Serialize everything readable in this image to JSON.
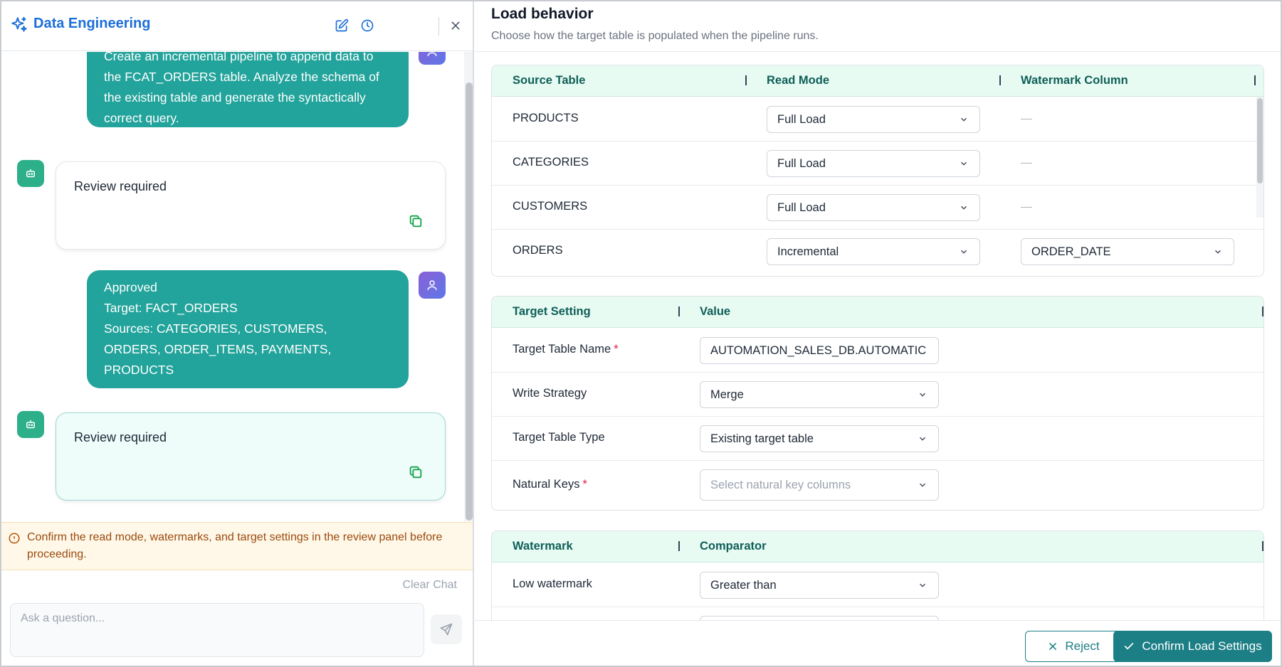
{
  "chat": {
    "title": "Data Engineering",
    "messages": {
      "user1_line1": "Create an incremental pipeline to append data to",
      "user1_line2": "the FCAT_ORDERS table. Analyze the schema of",
      "user1_line3": "the existing table and generate the syntactically",
      "user1_line4": "correct query.",
      "bot1": "Review required",
      "user2_line1": "Approved",
      "user2_line2": "Target: FACT_ORDERS",
      "user2_line3": "Sources: CATEGORIES, CUSTOMERS,",
      "user2_line4": "ORDERS, ORDER_ITEMS, PAYMENTS,",
      "user2_line5": "PRODUCTS",
      "bot2": "Review required"
    },
    "warning": "Confirm the read mode, watermarks, and target settings in the review panel before proceeding.",
    "clear_chat": "Clear Chat",
    "input_placeholder": "Ask a question..."
  },
  "review": {
    "title": "Load behavior",
    "subtitle": "Choose how the target table is populated when the pipeline runs.",
    "sources": {
      "headers": {
        "source": "Source Table",
        "read_mode": "Read Mode",
        "watermark": "Watermark Column"
      },
      "rows": [
        {
          "table": "PRODUCTS",
          "mode": "Full Load",
          "watermark": ""
        },
        {
          "table": "CATEGORIES",
          "mode": "Full Load",
          "watermark": ""
        },
        {
          "table": "CUSTOMERS",
          "mode": "Full Load",
          "watermark": ""
        },
        {
          "table": "ORDERS",
          "mode": "Incremental",
          "watermark": "ORDER_DATE"
        }
      ]
    },
    "target": {
      "headers": {
        "setting": "Target Setting",
        "value": "Value"
      },
      "table_name_label": "Target Table Name",
      "table_name_value": "AUTOMATION_SALES_DB.AUTOMATIC",
      "write_strategy_label": "Write Strategy",
      "write_strategy_value": "Merge",
      "table_type_label": "Target Table Type",
      "table_type_value": "Existing target table",
      "natural_keys_label": "Natural Keys",
      "natural_keys_placeholder": "Select natural key columns",
      "required_mark": "*"
    },
    "watermark": {
      "headers": {
        "watermark": "Watermark",
        "comparator": "Comparator"
      },
      "low_label": "Low watermark",
      "low_value": "Greater than"
    },
    "actions": {
      "reject": "Reject",
      "confirm": "Confirm Load Settings"
    }
  },
  "colors": {
    "accent": "#1c7f86",
    "bubble": "#22a39b",
    "title_blue": "#1d6fd8",
    "warning_bg": "#fff8e8"
  }
}
